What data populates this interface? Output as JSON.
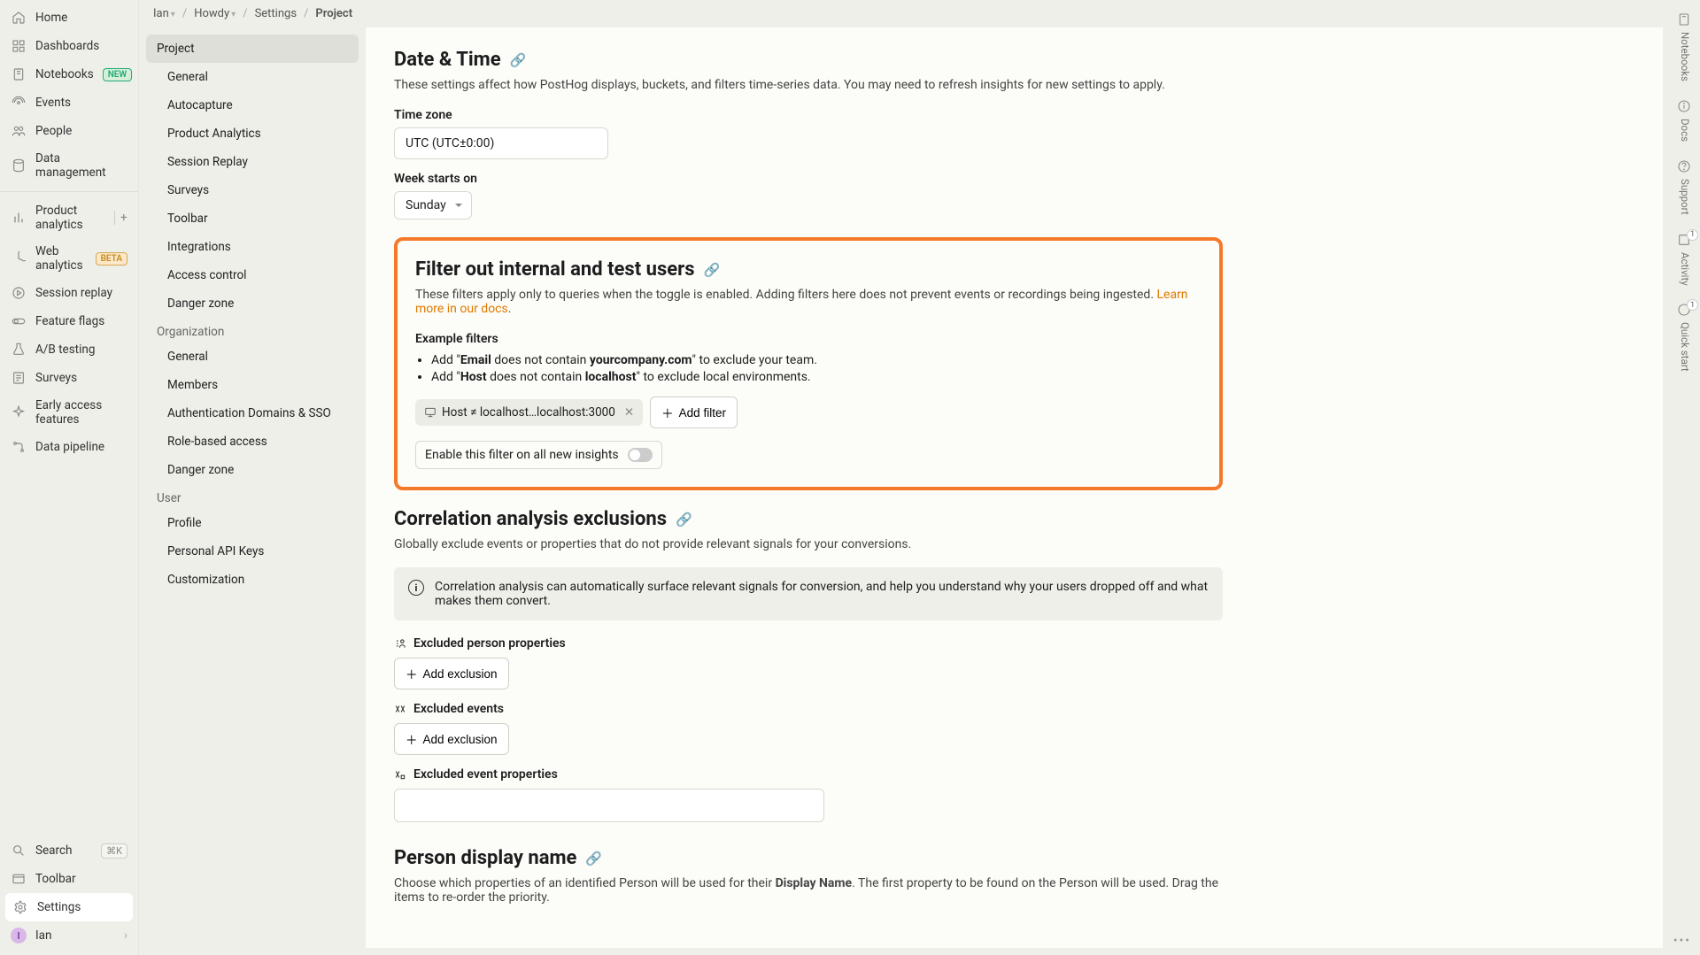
{
  "breadcrumb": {
    "org": "Ian",
    "project": "Howdy",
    "area": "Settings",
    "page": "Project"
  },
  "left_nav": {
    "home": "Home",
    "dashboards": "Dashboards",
    "notebooks": "Notebooks",
    "notebooks_tag": "NEW",
    "events": "Events",
    "people": "People",
    "data_mgmt": "Data management",
    "product_analytics": "Product analytics",
    "web_analytics": "Web analytics",
    "web_tag": "BETA",
    "session_replay": "Session replay",
    "feature_flags": "Feature flags",
    "ab_testing": "A/B testing",
    "surveys": "Surveys",
    "early_access": "Early access features",
    "data_pipeline": "Data pipeline",
    "search": "Search",
    "search_kbd": "⌘K",
    "toolbar": "Toolbar",
    "settings": "Settings",
    "user": "Ian",
    "user_initial": "I"
  },
  "settings_nav": {
    "project": "Project",
    "project_items": [
      "General",
      "Autocapture",
      "Product Analytics",
      "Session Replay",
      "Surveys",
      "Toolbar",
      "Integrations",
      "Access control",
      "Danger zone"
    ],
    "organization": "Organization",
    "org_items": [
      "General",
      "Members",
      "Authentication Domains & SSO",
      "Role-based access",
      "Danger zone"
    ],
    "user": "User",
    "user_items": [
      "Profile",
      "Personal API Keys",
      "Customization"
    ]
  },
  "sections": {
    "date_time": {
      "title": "Date & Time",
      "desc": "These settings affect how PostHog displays, buckets, and filters time-series data. You may need to refresh insights for new settings to apply.",
      "tz_label": "Time zone",
      "tz_value": "UTC (UTC±0:00)",
      "week_label": "Week starts on",
      "week_value": "Sunday"
    },
    "filter": {
      "title": "Filter out internal and test users",
      "desc_1": "These filters apply only to queries when the toggle is enabled. Adding filters here does not prevent events or recordings being ingested. ",
      "learn": "Learn more in our docs",
      "examples_head": "Example filters",
      "ex1_pre": "Add \"",
      "ex1_bold": "Email",
      "ex1_mid": " does not contain ",
      "ex1_bold2": "yourcompany.com",
      "ex1_post": "\" to exclude your team.",
      "ex2_pre": "Add \"",
      "ex2_bold": "Host",
      "ex2_mid": " does not contain ",
      "ex2_bold2": "localhost",
      "ex2_post": "\" to exclude local environments.",
      "chip": "Host ≠ localhost…localhost:3000",
      "add_filter": "Add filter",
      "toggle_label": "Enable this filter on all new insights"
    },
    "corr": {
      "title": "Correlation analysis exclusions",
      "desc": "Globally exclude events or properties that do not provide relevant signals for your conversions.",
      "banner": "Correlation analysis can automatically surface relevant signals for conversion, and help you understand why your users dropped off and what makes them convert.",
      "ex_person": "Excluded person properties",
      "ex_events": "Excluded events",
      "ex_event_props": "Excluded event properties",
      "add_exclusion": "Add exclusion"
    },
    "person": {
      "title": "Person display name",
      "desc_pre": "Choose which properties of an identified Person will be used for their ",
      "desc_bold": "Display Name",
      "desc_post": ". The first property to be found on the Person will be used. Drag the items to re-order the priority."
    }
  },
  "right_rail": {
    "notebooks": "Notebooks",
    "docs": "Docs",
    "support": "Support",
    "activity": "Activity",
    "quick_start": "Quick start",
    "badge_one": "1"
  }
}
